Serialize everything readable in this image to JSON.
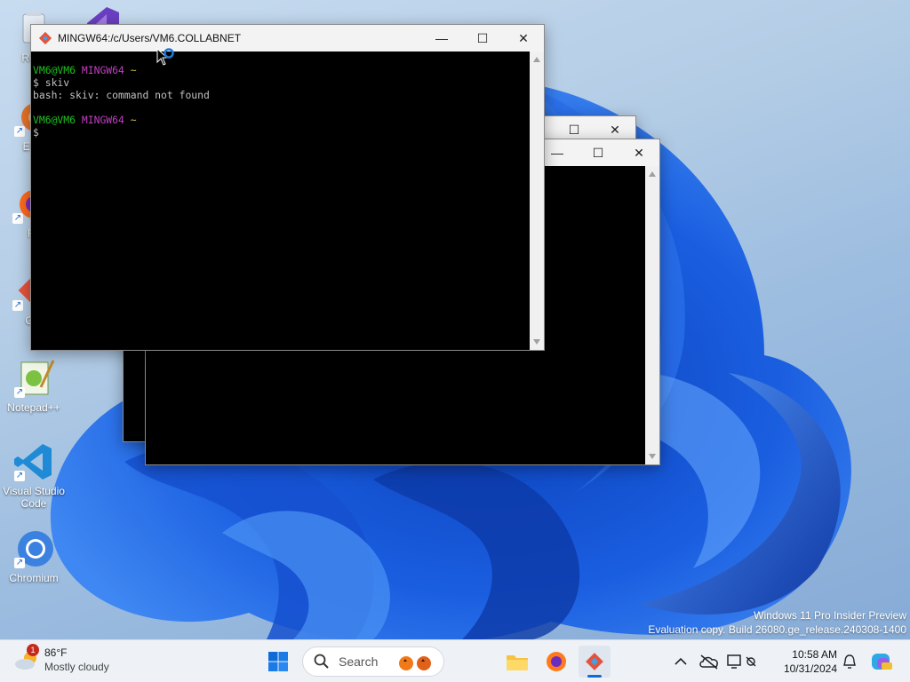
{
  "desktop": {
    "icons": [
      {
        "label": "Recy"
      },
      {
        "label": "Ever"
      },
      {
        "label": "Fi"
      },
      {
        "label": "Git"
      },
      {
        "label": "Notepad++"
      },
      {
        "label": "Visual Studio Code"
      },
      {
        "label": "Chromium"
      }
    ],
    "watermark": {
      "line1": "Windows 11 Pro Insider Preview",
      "line2": "Evaluation copy. Build 26080.ge_release.240308-1400"
    }
  },
  "terminal_main": {
    "title": "MINGW64:/c/Users/VM6.COLLABNET",
    "lines": [
      {
        "user": "VM6@VM6",
        "host": "MINGW64",
        "path": "~"
      },
      {
        "cmd": "$ skiv"
      },
      {
        "out": "bash: skiv: command not found"
      },
      {
        "out": ""
      },
      {
        "user": "VM6@VM6",
        "host": "MINGW64",
        "path": "~"
      },
      {
        "cmd": "$"
      }
    ]
  },
  "window_controls": {
    "minimize": "—",
    "maximize": "☐",
    "close": "✕"
  },
  "taskbar": {
    "weather": {
      "temp": "86°F",
      "condition": "Mostly cloudy",
      "badge": "1"
    },
    "search_placeholder": "Search",
    "clock": {
      "time": "10:58 AM",
      "date": "10/31/2024"
    }
  },
  "icons": {
    "start": "windows-logo-icon",
    "search": "search-icon",
    "explorer": "folder-icon",
    "firefox": "firefox-icon",
    "git": "git-bash-icon",
    "chevron": "chevron-up-icon",
    "network": "network-icon",
    "notification": "bell-icon"
  }
}
